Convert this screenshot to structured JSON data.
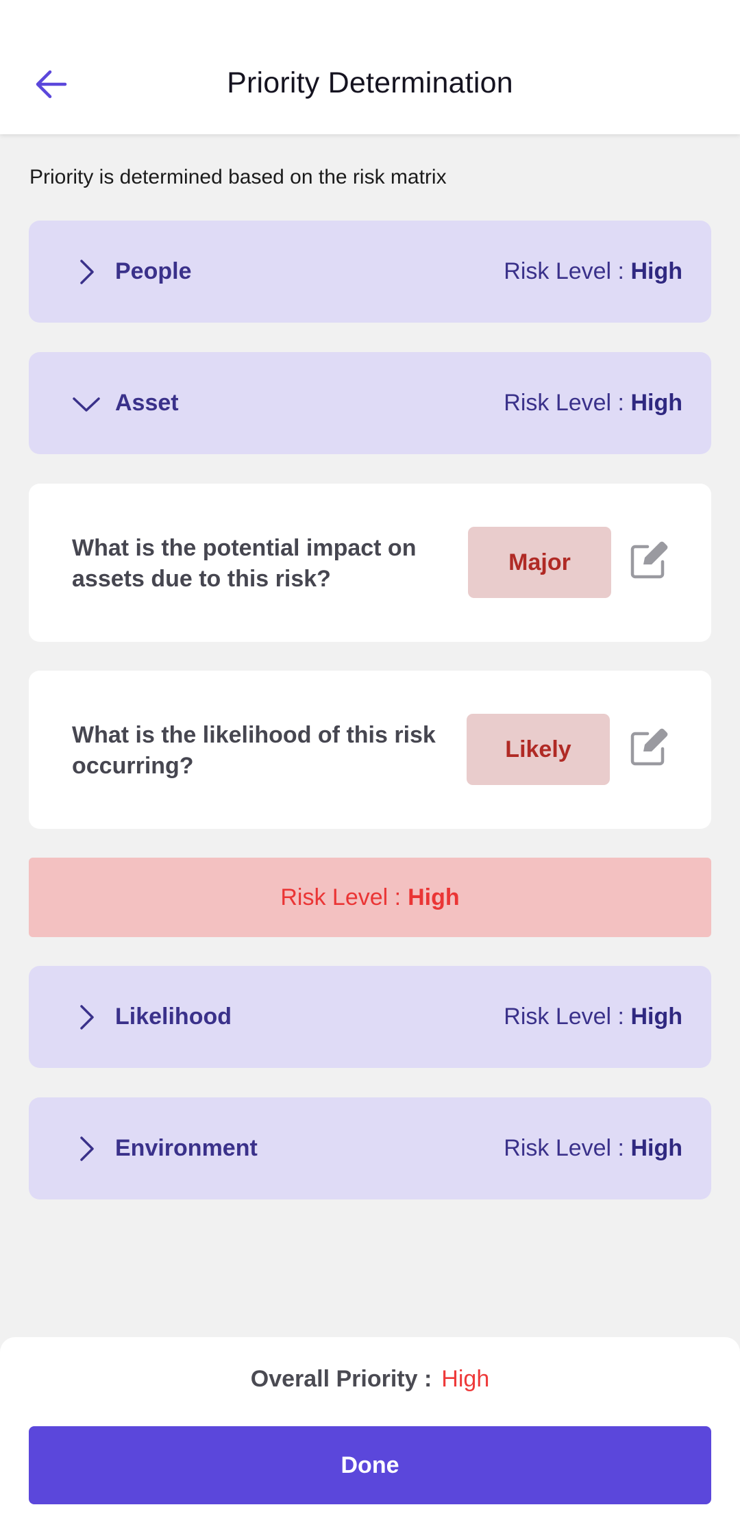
{
  "header": {
    "title": "Priority Determination",
    "back_icon": "arrow-left-icon"
  },
  "subtitle": "Priority is determined based on the risk matrix",
  "risk_level_label": "Risk Level :",
  "sections": [
    {
      "label": "People",
      "risk": "High",
      "expanded": false
    },
    {
      "label": "Asset",
      "risk": "High",
      "expanded": true
    },
    {
      "label": "Likelihood",
      "risk": "High",
      "expanded": false
    },
    {
      "label": "Environment",
      "risk": "High",
      "expanded": false
    }
  ],
  "asset_questions": [
    {
      "text": "What is the potential impact on assets due to this risk?",
      "answer": "Major"
    },
    {
      "text": "What is the likelihood of this risk occurring?",
      "answer": "Likely"
    }
  ],
  "asset_result": {
    "label": "Risk Level :",
    "value": "High"
  },
  "footer": {
    "overall_label": "Overall Priority :",
    "overall_value": "High",
    "done_label": "Done"
  },
  "colors": {
    "accent": "#5b47db",
    "section_bg": "#dfdbf6",
    "section_text": "#3a318a",
    "danger": "#ea3535",
    "danger_bg": "#f3c1c1",
    "pill_bg": "#e9cccc",
    "pill_text": "#b02a25"
  }
}
